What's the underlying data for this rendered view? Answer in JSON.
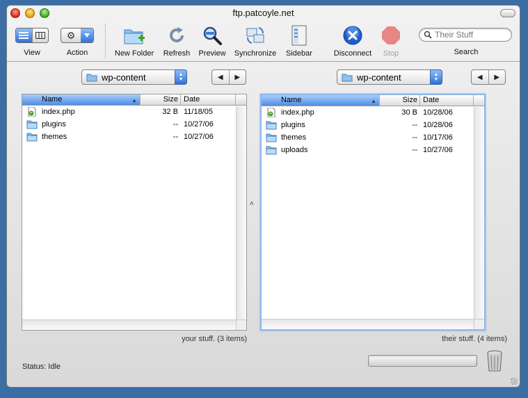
{
  "window": {
    "title": "ftp.patcoyle.net"
  },
  "toolbar": {
    "view_label": "View",
    "action_label": "Action",
    "new_folder_label": "New Folder",
    "refresh_label": "Refresh",
    "preview_label": "Preview",
    "synchronize_label": "Synchronize",
    "sidebar_label": "Sidebar",
    "disconnect_label": "Disconnect",
    "stop_label": "Stop",
    "search_label": "Search",
    "search_placeholder": "Their Stuff"
  },
  "left_pane": {
    "path": "wp-content",
    "columns": {
      "name": "Name",
      "size": "Size",
      "date": "Date"
    },
    "items": [
      {
        "name": "index.php",
        "size": "32 B",
        "date": "11/18/05",
        "kind": "php-file-icon"
      },
      {
        "name": "plugins",
        "size": "--",
        "date": "10/27/06",
        "kind": "folder-icon"
      },
      {
        "name": "themes",
        "size": "--",
        "date": "10/27/06",
        "kind": "folder-icon"
      }
    ],
    "summary": "your stuff. (3 items)"
  },
  "right_pane": {
    "path": "wp-content",
    "columns": {
      "name": "Name",
      "size": "Size",
      "date": "Date"
    },
    "items": [
      {
        "name": "index.php",
        "size": "30 B",
        "date": "10/28/06",
        "kind": "php-file-icon"
      },
      {
        "name": "plugins",
        "size": "--",
        "date": "10/28/06",
        "kind": "folder-icon"
      },
      {
        "name": "themes",
        "size": "--",
        "date": "10/17/06",
        "kind": "folder-icon"
      },
      {
        "name": "uploads",
        "size": "--",
        "date": "10/27/06",
        "kind": "folder-icon"
      }
    ],
    "summary": "their stuff. (4 items)"
  },
  "status": {
    "text": "Status: Idle"
  },
  "colors": {
    "accent": "#2f72d8",
    "selection_header": "#4f8de3",
    "focus_ring": "#8fb6ec",
    "disconnect_blue": "#1e5fd0",
    "stop_red": "#e04040"
  }
}
